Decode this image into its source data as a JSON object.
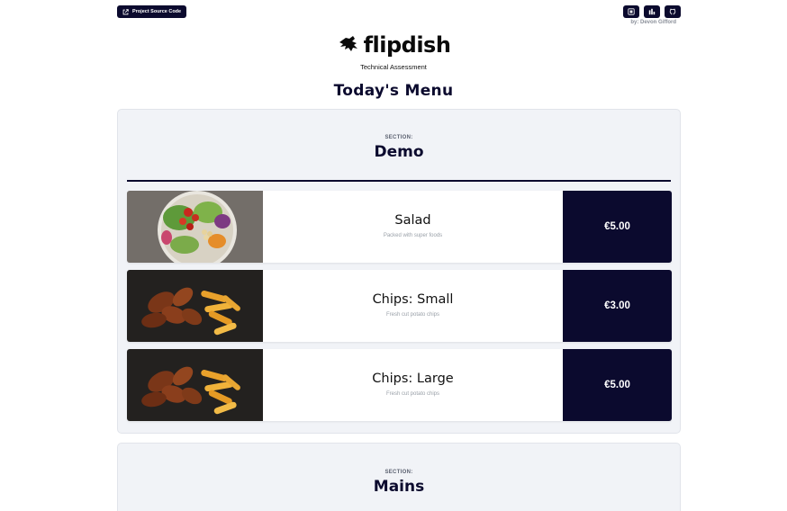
{
  "header": {
    "source_button_label": "Project Source Code",
    "source_icon": "external-link-icon",
    "icon_buttons": [
      "portfolio-icon",
      "bar-chart-icon",
      "github-icon"
    ],
    "byline": "by: Devon Gifford"
  },
  "brand": {
    "logo_text": "flipdish",
    "tagline": "Technical Assessment"
  },
  "page_title": "Today's Menu",
  "sections": [
    {
      "label": "SECTION:",
      "name": "Demo",
      "items": [
        {
          "name": "Salad",
          "description": "Packed with super foods",
          "price": "€5.00",
          "image": "salad-bowl-photo"
        },
        {
          "name": "Chips: Small",
          "description": "Fresh cut potato chips",
          "price": "€3.00",
          "image": "wings-and-chips-photo"
        },
        {
          "name": "Chips: Large",
          "description": "Fresh cut potato chips",
          "price": "€5.00",
          "image": "wings-and-chips-photo"
        }
      ]
    },
    {
      "label": "SECTION:",
      "name": "Mains",
      "items": []
    }
  ],
  "colors": {
    "navy": "#0b0a2e",
    "section_bg": "#f1f3f7",
    "muted_text": "#9aa0a8"
  }
}
